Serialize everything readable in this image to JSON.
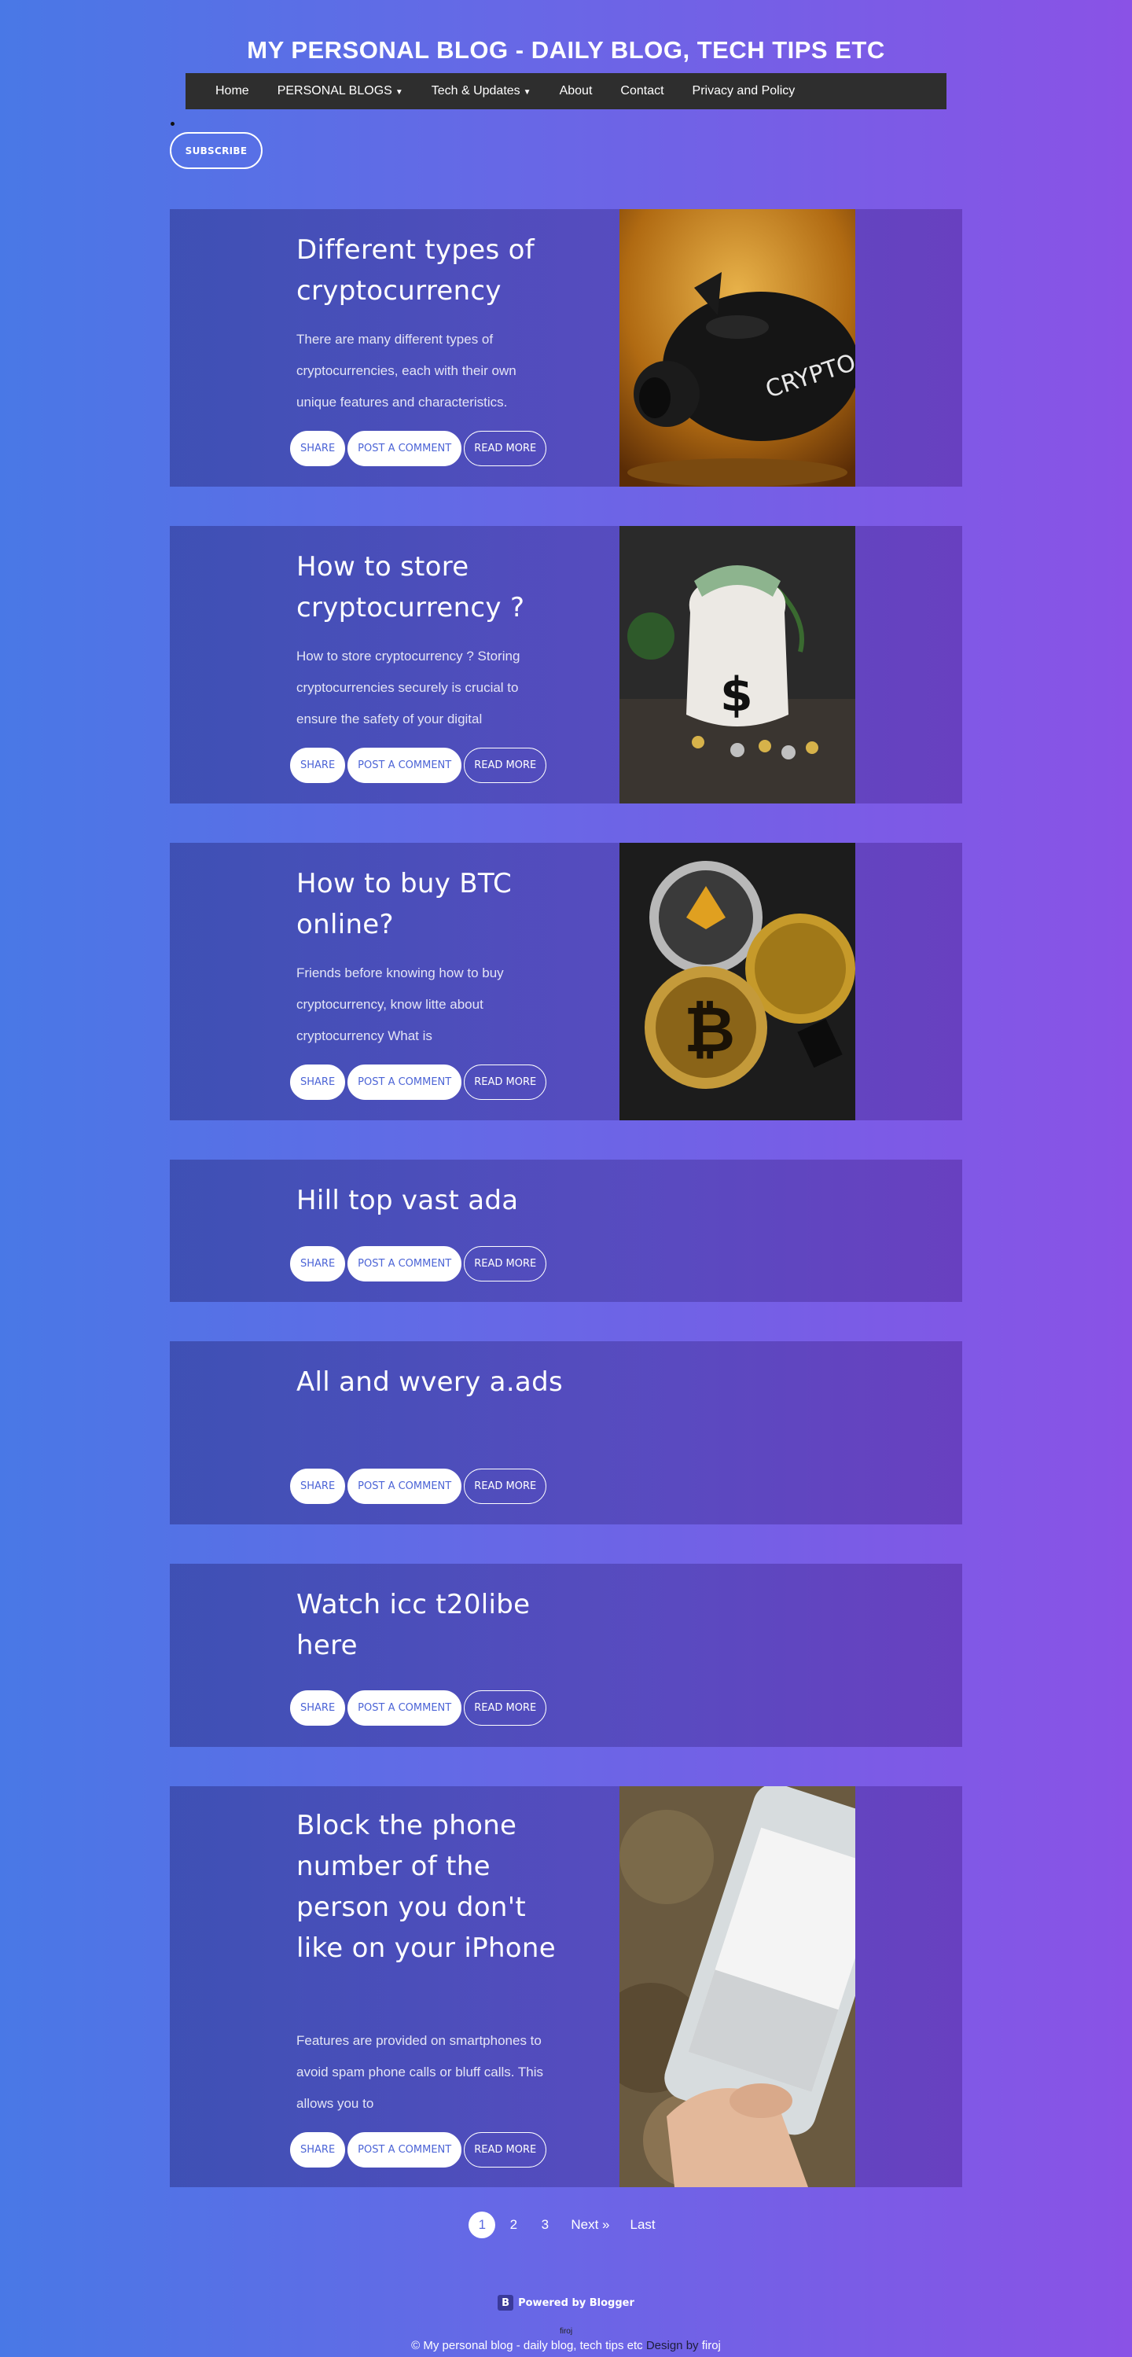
{
  "header": {
    "title": "MY PERSONAL BLOG - DAILY BLOG, TECH TIPS ETC"
  },
  "nav": {
    "items": [
      {
        "label": "Home",
        "dropdown": false
      },
      {
        "label": "PERSONAL BLOGS",
        "dropdown": true
      },
      {
        "label": "Tech & Updates",
        "dropdown": true
      },
      {
        "label": "About",
        "dropdown": false
      },
      {
        "label": "Contact",
        "dropdown": false
      },
      {
        "label": "Privacy and Policy",
        "dropdown": false
      }
    ]
  },
  "subscribe_label": "SUBSCRIBE",
  "buttons": {
    "share": "SHARE",
    "comment": "POST A COMMENT",
    "read_more": "READ MORE"
  },
  "posts": [
    {
      "title": "Different types of cryptocurrency",
      "excerpt": "There are many different types of cryptocurrencies, each with their own unique features and characteristics.",
      "image": "crypto-piggy-bank"
    },
    {
      "title": "How to store cryptocurrency ?",
      "excerpt": "How to store cryptocurrency ? Storing cryptocurrencies securely is crucial to ensure the safety of your digital",
      "image": "money-bag"
    },
    {
      "title": "How to buy BTC online?",
      "excerpt": "Friends before knowing how to buy cryptocurrency, know litte about cryptocurrency  What is",
      "image": "crypto-coins"
    },
    {
      "title": "Hill top vast ada",
      "excerpt": "",
      "image": ""
    },
    {
      "title": "All and wvery a.ads",
      "excerpt": "",
      "image": ""
    },
    {
      "title": "Watch icc t20libe here",
      "excerpt": "",
      "image": ""
    },
    {
      "title": "Block the phone number of the person you don't like on your iPhone",
      "excerpt": "Features are provided on smartphones to avoid spam phone calls or bluff calls. This allows you to",
      "image": "phone-in-hand"
    }
  ],
  "pagination": {
    "pages": [
      "1",
      "2",
      "3"
    ],
    "current": "1",
    "next": "Next »",
    "last": "Last"
  },
  "footer": {
    "powered": "Powered by Blogger",
    "author_small": "firoj",
    "copyright": "© My personal blog - daily blog, tech tips etc",
    "design_by": "Design by",
    "designer": "firoj"
  },
  "colors": {
    "gradient_left": "#4978e6",
    "gradient_right": "#8a52e6",
    "nav_bg": "#2e2e2e",
    "button_text": "#4c64d6"
  }
}
